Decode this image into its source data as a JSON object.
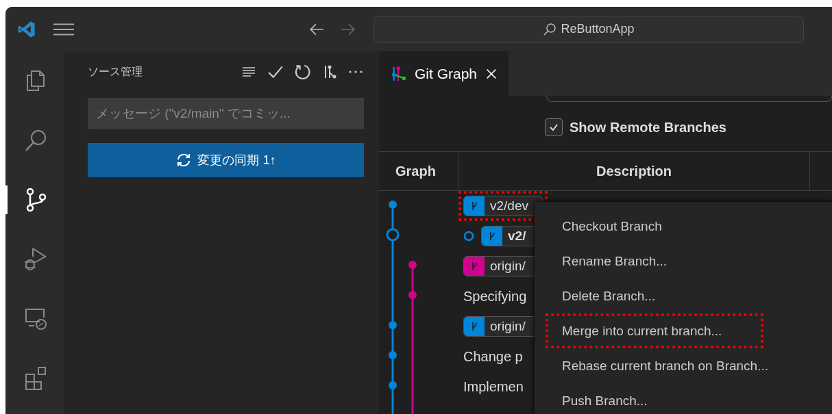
{
  "titlebar": {
    "search": "ReButtonApp"
  },
  "activity_bar": [
    {
      "selected": false
    },
    {
      "selected": false
    },
    {
      "selected": true
    },
    {
      "selected": false
    },
    {
      "selected": false
    },
    {
      "selected": false
    }
  ],
  "sidebar": {
    "title": "ソース管理",
    "message_placeholder": "メッセージ (\"v2/main\" でコミッ...",
    "sync_button": "変更の同期 1↑"
  },
  "tabs": [
    {
      "label": "Git Graph",
      "selected": true
    }
  ],
  "options": {
    "show_remote_branches": {
      "label": "Show Remote Branches",
      "checked": true
    }
  },
  "table": {
    "columns": [
      "Graph",
      "Description"
    ],
    "rows": [
      {
        "kind": "ref",
        "ref": {
          "label": "v2/dev",
          "color": "#0085d9",
          "head": false,
          "highlighted": true
        }
      },
      {
        "kind": "ref",
        "ref": {
          "label": "v2/",
          "color": "#0085d9",
          "head": true,
          "highlighted": false
        }
      },
      {
        "kind": "ref",
        "ref": {
          "label": "origin/",
          "color": "#d1038e",
          "head": false,
          "highlighted": false
        }
      },
      {
        "kind": "text",
        "text": "Specifying"
      },
      {
        "kind": "ref",
        "ref": {
          "label": "origin/",
          "color": "#0085d9",
          "head": false,
          "highlighted": false
        }
      },
      {
        "kind": "text",
        "text": "Change p"
      },
      {
        "kind": "text",
        "text": "Implemen"
      }
    ]
  },
  "context_menu": [
    {
      "label": "Checkout Branch",
      "highlighted": false
    },
    {
      "label": "Rename Branch...",
      "highlighted": false
    },
    {
      "label": "Delete Branch...",
      "highlighted": false
    },
    {
      "label": "Merge into current branch...",
      "highlighted": true
    },
    {
      "label": "Rebase current branch on Branch...",
      "highlighted": false
    },
    {
      "label": "Push Branch...",
      "highlighted": false
    }
  ]
}
